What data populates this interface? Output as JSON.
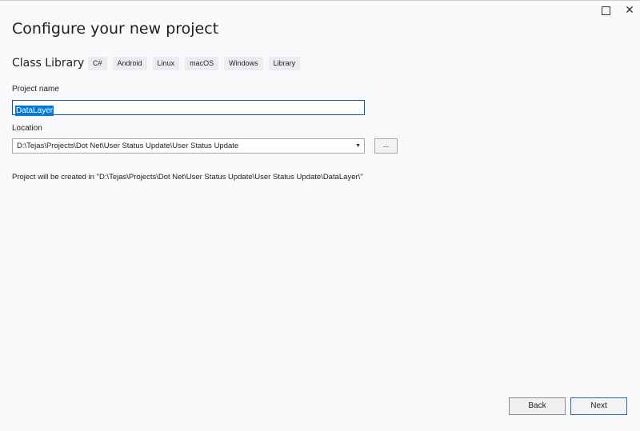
{
  "window": {
    "maximize_icon": "maximize-icon",
    "close_icon": "close-icon",
    "close_glyph": "✕"
  },
  "header": {
    "title": "Configure your new project"
  },
  "template": {
    "name": "Class Library",
    "tags": [
      "C#",
      "Android",
      "Linux",
      "macOS",
      "Windows",
      "Library"
    ]
  },
  "form": {
    "project_name_label": "Project name",
    "project_name_value": "DataLayer",
    "location_label": "Location",
    "location_value": "D:\\Tejas\\Projects\\Dot Net\\User Status Update\\User Status Update",
    "browse_label": "...",
    "created_in_text": "Project will be created in \"D:\\Tejas\\Projects\\Dot Net\\User Status Update\\User Status Update\\DataLayer\\\""
  },
  "footer": {
    "back_label": "Back",
    "next_label": "Next"
  },
  "colors": {
    "selection": "#0078d7",
    "focus_border": "#0e5aa7"
  }
}
